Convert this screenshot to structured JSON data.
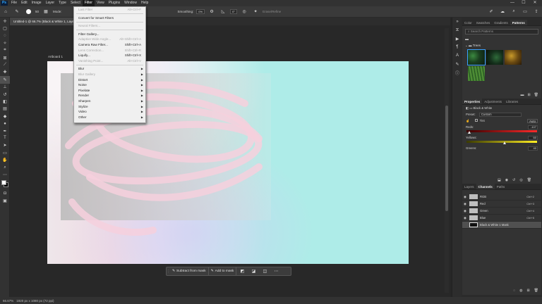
{
  "menubar": {
    "logo": "Ps",
    "items": [
      "File",
      "Edit",
      "Image",
      "Layer",
      "Type",
      "Select",
      "Filter",
      "View",
      "Plugins",
      "Window",
      "Help"
    ],
    "active_index": 6
  },
  "options_bar": {
    "brush_size": "50",
    "mode_label": "Mode:",
    "smoothing_label": "Smoothing:",
    "smoothing_value": "0%",
    "angle_value": "0°",
    "symmetry_label": "Erase/Refine"
  },
  "document_tab": {
    "title": "Untitled-1 @ 66.7% (Black & White 1, Layer Mask/8) *"
  },
  "canvas": {
    "artboard_label": "Artboard 1"
  },
  "filter_menu": {
    "items": [
      {
        "label": "Last Filter",
        "shortcut": "Alt+Ctrl+F",
        "disabled": true
      },
      {
        "sep": true
      },
      {
        "label": "Convert for Smart Filters",
        "shortcut": "",
        "disabled": false
      },
      {
        "sep": true
      },
      {
        "label": "Neural Filters...",
        "shortcut": "",
        "disabled": true
      },
      {
        "sep": true
      },
      {
        "label": "Filter Gallery...",
        "shortcut": "",
        "disabled": false
      },
      {
        "label": "Adaptive Wide Angle...",
        "shortcut": "Alt+Shift+Ctrl+A",
        "disabled": true
      },
      {
        "label": "Camera Raw Filter...",
        "shortcut": "Shift+Ctrl+A",
        "disabled": false
      },
      {
        "label": "Lens Correction...",
        "shortcut": "Shift+Ctrl+R",
        "disabled": true
      },
      {
        "label": "Liquify...",
        "shortcut": "Shift+Ctrl+X",
        "disabled": false
      },
      {
        "label": "Vanishing Point...",
        "shortcut": "Alt+Ctrl+V",
        "disabled": true
      },
      {
        "sep": true
      },
      {
        "label": "Blur",
        "submenu": true,
        "disabled": false
      },
      {
        "label": "Blur Gallery",
        "submenu": true,
        "disabled": true
      },
      {
        "label": "Distort",
        "submenu": true,
        "disabled": false
      },
      {
        "label": "Noise",
        "submenu": true,
        "disabled": false
      },
      {
        "label": "Pixelate",
        "submenu": true,
        "disabled": false
      },
      {
        "label": "Render",
        "submenu": true,
        "disabled": false
      },
      {
        "label": "Sharpen",
        "submenu": true,
        "disabled": false
      },
      {
        "label": "Stylize",
        "submenu": true,
        "disabled": false
      },
      {
        "label": "Video",
        "submenu": true,
        "disabled": false
      },
      {
        "label": "Other",
        "submenu": true,
        "disabled": false
      }
    ]
  },
  "taskbar": {
    "subtract": "Subtract from mask",
    "add": "Add to mask"
  },
  "status": {
    "zoom": "66.67%",
    "size": "1920 px x 1080 px (72 ppi)"
  },
  "patterns_panel": {
    "tabs": [
      "Color",
      "Swatches",
      "Gradients",
      "Patterns"
    ],
    "active_tab": 3,
    "search_placeholder": "Search Patterns",
    "folder": "Trees"
  },
  "properties_panel": {
    "tabs": [
      "Properties",
      "Adjustments",
      "Libraries"
    ],
    "active_tab": 0,
    "title": "Black & White",
    "preset_label": "Preset:",
    "preset_value": "Custom",
    "tint_label": "Tint",
    "auto_label": "Auto",
    "reds_label": "Reds:",
    "reds_value": "-107",
    "yellows_label": "Yellows:",
    "yellows_value": "60",
    "greens_label": "Greens:",
    "greens_value": "40"
  },
  "channels_panel": {
    "tabs": [
      "Layers",
      "Channels",
      "Paths"
    ],
    "active_tab": 1,
    "rows": [
      {
        "name": "RGB",
        "shortcut": "Ctrl+2"
      },
      {
        "name": "Red",
        "shortcut": "Ctrl+3"
      },
      {
        "name": "Green",
        "shortcut": "Ctrl+4"
      },
      {
        "name": "Blue",
        "shortcut": "Ctrl+5"
      },
      {
        "name": "Black & White 1 Mask",
        "shortcut": "",
        "selected": true
      }
    ]
  }
}
